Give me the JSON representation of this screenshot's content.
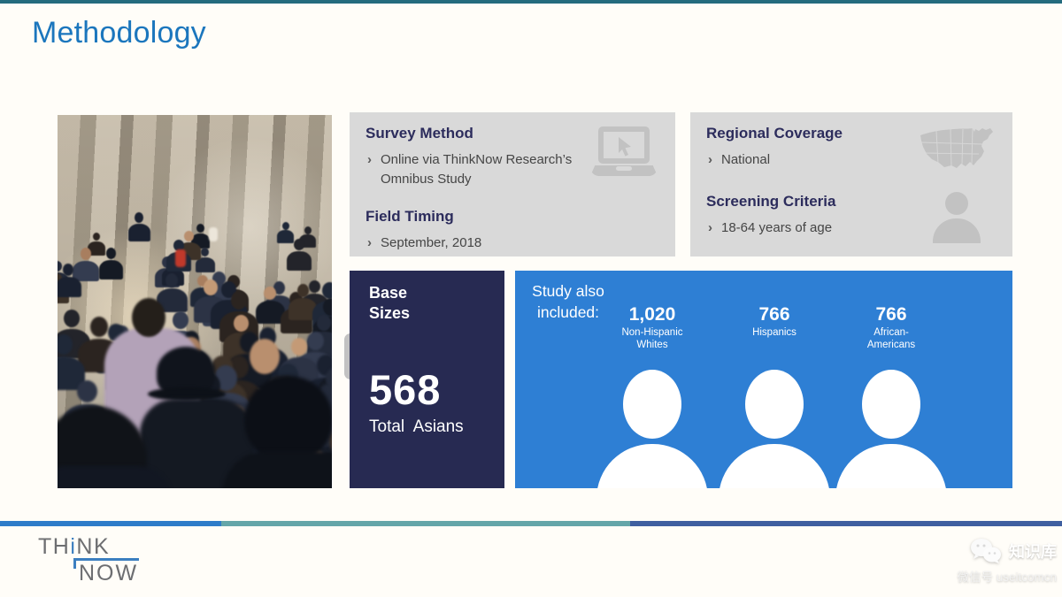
{
  "title": "Methodology",
  "chevron": "›",
  "cards": {
    "survey_method": {
      "heading": "Survey Method",
      "bullet": "Online via ThinkNow Research’s Omnibus Study"
    },
    "field_timing": {
      "heading": "Field Timing",
      "bullet": "September, 2018"
    },
    "regional_coverage": {
      "heading": "Regional Coverage",
      "bullet": "National"
    },
    "screening_criteria": {
      "heading": "Screening Criteria",
      "bullet": "18-64 years of age"
    }
  },
  "base_sizes": {
    "heading": "Base\nSizes",
    "value": "568",
    "caption": "Total  Asians"
  },
  "study": {
    "intro": "Study also\nincluded:",
    "groups": [
      {
        "value": "1,020",
        "label": "Non-Hispanic\nWhites"
      },
      {
        "value": "766",
        "label": "Hispanics"
      },
      {
        "value": "766",
        "label": "African-\nAmericans"
      }
    ]
  },
  "logo": {
    "th": "TH",
    "i": "i",
    "nk": "NK",
    "now": "NOW"
  },
  "watermark": {
    "title": "知识库",
    "subtitle": "微信号 useitcomcn"
  },
  "colors": {
    "title_blue": "#1b76bd",
    "navy": "#272a52",
    "card_gray": "#d9d9d9",
    "accent_blue": "#2e7fd4",
    "divider_teal": "#64a6a9",
    "divider_slate": "#3f5fa0",
    "topline_teal": "#246b7e"
  }
}
